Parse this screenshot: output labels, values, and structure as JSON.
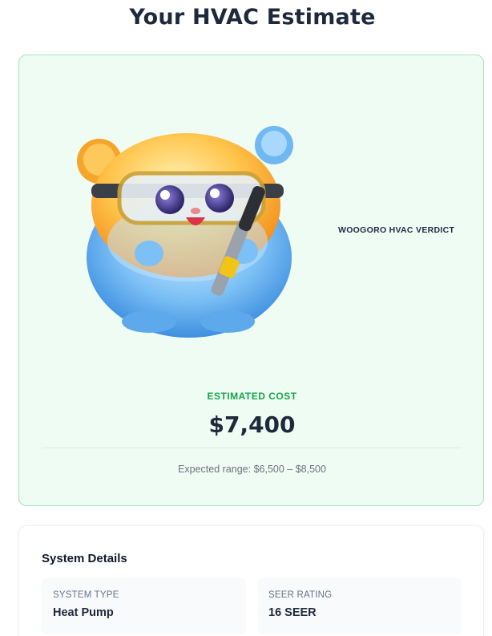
{
  "page": {
    "title": "Your HVAC Estimate"
  },
  "estimate": {
    "verdict_label": "WOOGORO HVAC VERDICT",
    "cost_label": "ESTIMATED COST",
    "cost_value": "$7,400",
    "range_text": "Expected range: $6,500 – $8,500",
    "mascot_icon": "fluffy-mascot-with-goggles-and-brush"
  },
  "details": {
    "title": "System Details",
    "items": [
      {
        "label": "SYSTEM TYPE",
        "value": "Heat Pump"
      },
      {
        "label": "SEER RATING",
        "value": "16 SEER"
      }
    ]
  },
  "colors": {
    "accent_green": "#16a34a",
    "card_bg": "#effcf3",
    "card_border": "#a7e3bd",
    "text_dark": "#1e293b"
  }
}
